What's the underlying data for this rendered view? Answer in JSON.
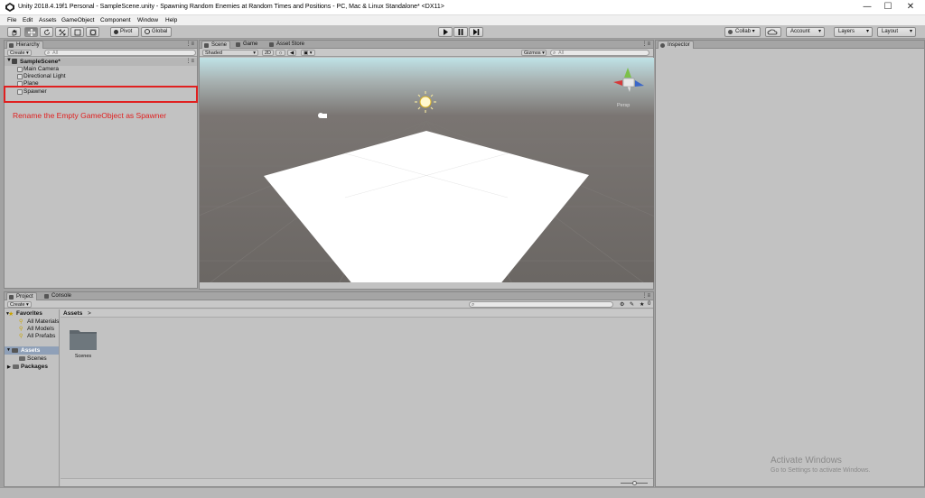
{
  "window": {
    "title": "Unity 2018.4.19f1 Personal - SampleScene.unity - Spawning Random Enemies at Random Times and Positions - PC, Mac & Linux Standalone* <DX11>",
    "minimize": "—",
    "maximize": "☐",
    "close": "✕"
  },
  "menu": [
    "File",
    "Edit",
    "Assets",
    "GameObject",
    "Component",
    "Window",
    "Help"
  ],
  "toolbar": {
    "pivot": "Pivot",
    "global": "Global",
    "collab": "Collab ▾",
    "account": "Account",
    "layers": "Layers",
    "layout": "Layout"
  },
  "hierarchy": {
    "tab": "Hierarchy",
    "create": "Create",
    "search_placeholder": "All",
    "scene": "SampleScene*",
    "items": [
      "Main Camera",
      "Directional Light",
      "Plane",
      "Spawner"
    ]
  },
  "scene": {
    "tabs": [
      "Scene",
      "Game",
      "Asset Store"
    ],
    "shading": "Shaded",
    "mode2d": "2D",
    "gizmos": "Gizmos",
    "search_placeholder": "All",
    "persp": "Persp"
  },
  "inspector": {
    "tab": "Inspector"
  },
  "project": {
    "tabs": [
      "Project",
      "Console"
    ],
    "create": "Create",
    "favorites_label": "Favorites",
    "favorites": [
      "All Materials",
      "All Models",
      "All Prefabs"
    ],
    "assets_label": "Assets",
    "asset_children": [
      "Scenes"
    ],
    "packages_label": "Packages",
    "breadcrumb": "Assets",
    "breadcrumb_sep": ">",
    "grid_items": [
      "Scenes"
    ],
    "badge_count": "0"
  },
  "annotation": {
    "text": "Rename the Empty GameObject as Spawner",
    "color": "#e02020"
  },
  "watermark": {
    "line1": "Activate Windows",
    "line2": "Go to Settings to activate Windows."
  },
  "colors": {
    "scene_ground": "#6a6663",
    "sky": "#b8d4d8",
    "plane": "#ffffff",
    "accent_red": "#e02020"
  }
}
